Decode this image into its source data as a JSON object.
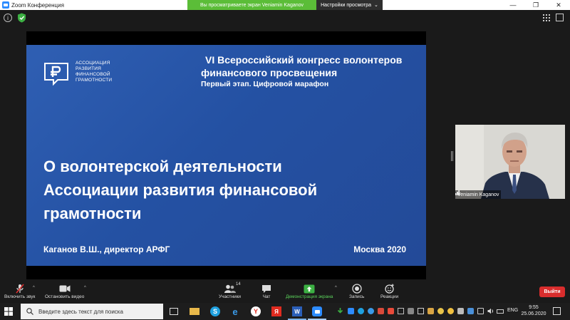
{
  "window": {
    "title": "Zoom Конференция",
    "share_banner": "Вы просматриваете экран Veniamin Kaganov",
    "view_options": "Настройки просмотра",
    "view_options_caret": "⌄"
  },
  "slide": {
    "logo_lines": [
      "АССОЦИАЦИЯ",
      "РАЗВИТИЯ",
      "ФИНАНСОВОЙ",
      "ГРАМОТНОСТИ"
    ],
    "congress_line1": "VI Всероссийский конгресс волонтеров",
    "congress_line2": "финансового просвещения",
    "congress_line3": "Первый этап. Цифровой марафон",
    "title_lines": [
      "О волонтерской деятельности",
      "Ассоциации развития финансовой",
      "грамотности"
    ],
    "author": "Каганов В.Ш., директор АРФГ",
    "city_date": "Москва 2020",
    "colors": {
      "background": "#2a56a6",
      "text": "#ffffff"
    }
  },
  "video": {
    "participant_name": "Veniamin Kaganov"
  },
  "toolbar": {
    "unmute_label": "Включить звук",
    "stop_video_label": "Остановить видео",
    "participants_label": "Участники",
    "participants_count": "14",
    "chat_label": "Чат",
    "share_label": "Демонстрация экрана",
    "record_label": "Запись",
    "reactions_label": "Реакции",
    "leave_label": "Выйти",
    "caret": "^",
    "colors": {
      "share": "#5bd35b",
      "leave": "#d92d2d"
    }
  },
  "taskbar": {
    "search_placeholder": "Введите здесь текст для поиска",
    "lang": "ENG",
    "time": "9:55",
    "date": "25.06.2020"
  }
}
